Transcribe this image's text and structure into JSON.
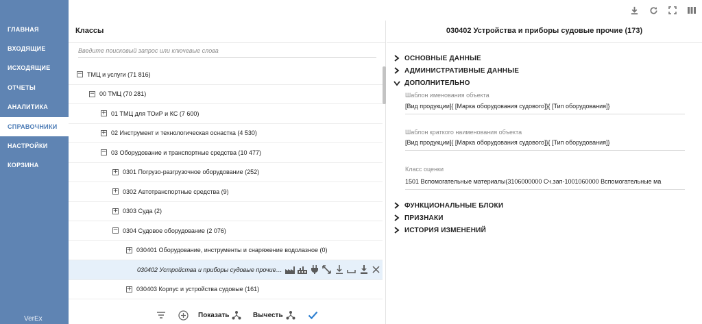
{
  "sidebar": {
    "items": [
      {
        "label": "ГЛАВНАЯ",
        "active": false
      },
      {
        "label": "ВХОДЯЩИЕ",
        "active": false
      },
      {
        "label": "ИСХОДЯЩИЕ",
        "active": false
      },
      {
        "label": "ОТЧЕТЫ",
        "active": false
      },
      {
        "label": "АНАЛИТИКА",
        "active": false
      },
      {
        "label": "СПРАВОЧНИКИ",
        "active": true
      },
      {
        "label": "НАСТРОЙКИ",
        "active": false
      },
      {
        "label": "КОРЗИНА",
        "active": false
      }
    ],
    "brand": "VerEx"
  },
  "toolbar": {
    "icons": [
      "download-icon",
      "refresh-icon",
      "fullscreen-icon",
      "columns-icon"
    ]
  },
  "left": {
    "title": "Классы",
    "search_placeholder": "Введите поисковый запрос или ключевые слова",
    "tree": [
      {
        "label": "ТМЦ и услуги (71 816)",
        "toggle": "−"
      },
      {
        "label": "00 ТМЦ (70 281)",
        "toggle": "−"
      },
      {
        "label": "01 ТМЦ для ТОиР и КС (7 600)",
        "toggle": "+"
      },
      {
        "label": "02 Инструмент и технологическая оснастка (4 530)",
        "toggle": "+"
      },
      {
        "label": "03 Оборудование и транспортные средства (10 477)",
        "toggle": "−"
      },
      {
        "label": "0301 Погрузо-разгрузочное оборудование (252)",
        "toggle": "+"
      },
      {
        "label": "0302 Автотранспортные средства (9)",
        "toggle": "+"
      },
      {
        "label": "0303 Суда (2)",
        "toggle": "+"
      },
      {
        "label": "0304 Судовое оборудование  (2 076)",
        "toggle": "−"
      },
      {
        "label": "030401 Оборудование, инструменты и снаряжение водолазное (0)",
        "toggle": "+"
      },
      {
        "label": "030402 Устройства и приборы судовые прочие (173)",
        "toggle": ""
      },
      {
        "label": "030403 Корпус и устройства судовые (161)",
        "toggle": "+"
      }
    ],
    "row_action_icons": [
      "factory-icon",
      "factory-alt-icon",
      "plug-icon",
      "expand-arrows-icon",
      "download-line-icon",
      "move-down-icon",
      "import-icon",
      "close-icon"
    ],
    "bottom": {
      "show_label": "Показать",
      "subtract_label": "Вычесть"
    }
  },
  "right": {
    "title": "030402 Устройства и приборы судовые прочие (173)",
    "sections": [
      {
        "label": "ОСНОВНЫЕ ДАННЫЕ",
        "expanded": false
      },
      {
        "label": "АДМИНИСТРАТИВНЫЕ ДАННЫЕ",
        "expanded": false
      },
      {
        "label": "ДОПОЛНИТЕЛЬНО",
        "expanded": true
      },
      {
        "label": "ФУНКЦИОНАЛЬНЫЕ БЛОКИ",
        "expanded": false
      },
      {
        "label": "ПРИЗНАКИ",
        "expanded": false
      },
      {
        "label": "ИСТОРИЯ ИЗМЕНЕНИЙ",
        "expanded": false
      }
    ],
    "fields": [
      {
        "label": "Шаблон именования объекта",
        "value": "[Вид продукции]{ [Марка оборудования судового]}{ [Тип оборудования]}"
      },
      {
        "label": "Шаблон краткого наименования объекта",
        "value": "[Вид продукции]{ [Марка оборудования судового]}{ [Тип оборудования]}"
      },
      {
        "label": "Класс оценки",
        "value": "1501 Вспомогательные материалы(3106000000 Сч.зап-1001060000 Вспомогательные ма"
      }
    ]
  },
  "colors": {
    "sidebar_bg": "#5f84b3",
    "active_text": "#4a7ab5",
    "selected_row_bg": "#e6f0fa",
    "check_blue": "#2f80d1"
  }
}
